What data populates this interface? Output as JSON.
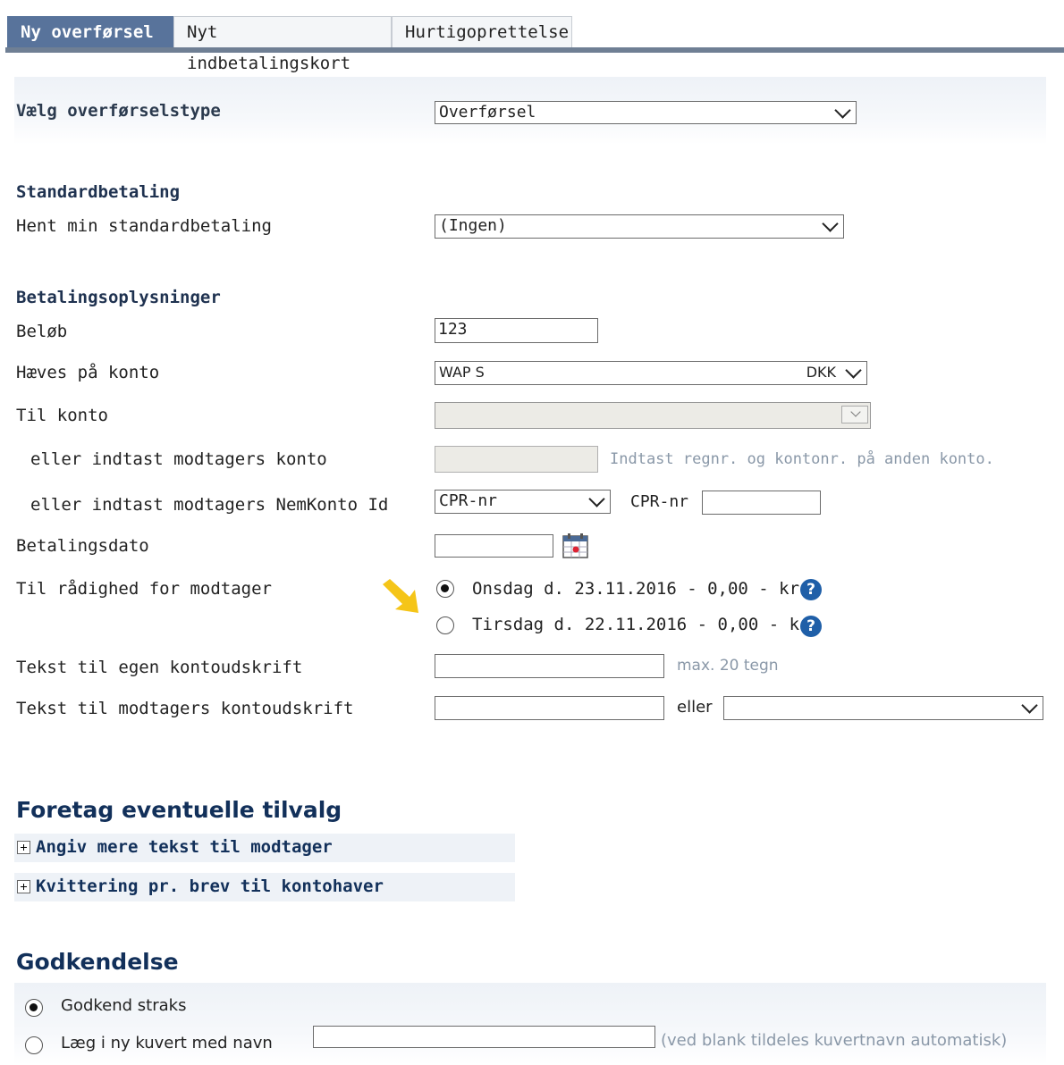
{
  "tabs": [
    {
      "label": "Ny overførsel",
      "active": true
    },
    {
      "label": "Nyt indbetalingskort",
      "active": false
    },
    {
      "label": "Hurtigoprettelse",
      "active": false
    }
  ],
  "transfer_type": {
    "label": "Vælg overførselstype",
    "value": "Overførsel"
  },
  "standard": {
    "heading": "Standardbetaling",
    "label": "Hent min standardbetaling",
    "value": "(Ingen)"
  },
  "payment": {
    "heading": "Betalingsoplysninger",
    "amount_label": "Beløb",
    "amount_value": "123",
    "debit_label": "Hæves på konto",
    "debit_value": "WAP S",
    "debit_currency": "DKK",
    "to_account_label": "Til konto",
    "enter_account_label": "eller indtast modtagers konto",
    "enter_account_hint": "Indtast regnr. og kontonr. på anden konto.",
    "nemkonto_label": "eller indtast modtagers NemKonto Id",
    "nemkonto_type": "CPR-nr",
    "nemkonto_field_label": "CPR-nr",
    "date_label": "Betalingsdato",
    "available_label": "Til rådighed for modtager",
    "option1": "Onsdag d. 23.11.2016 - 0,00 - kr.",
    "option2": "Tirsdag d. 22.11.2016 - 0,00 - kr.",
    "help_glyph": "?",
    "own_text_label": "Tekst til egen kontoudskrift",
    "own_text_hint": "max. 20 tegn",
    "recipient_text_label": "Tekst til modtagers kontoudskrift",
    "or_label": "eller"
  },
  "options": {
    "heading": "Foretag eventuelle tilvalg",
    "more_text": "Angiv mere tekst til modtager",
    "receipt": "Kvittering pr. brev til kontohaver"
  },
  "approval": {
    "heading": "Godkendelse",
    "approve_now": "Godkend straks",
    "new_envelope": "Læg i ny kuvert med navn",
    "envelope_hint": "(ved blank tildeles kuvertnavn automatisk)"
  },
  "colors": {
    "accent": "#58739b",
    "heading": "#12305a",
    "help": "#1f5fa8",
    "arrow": "#f5c518"
  }
}
